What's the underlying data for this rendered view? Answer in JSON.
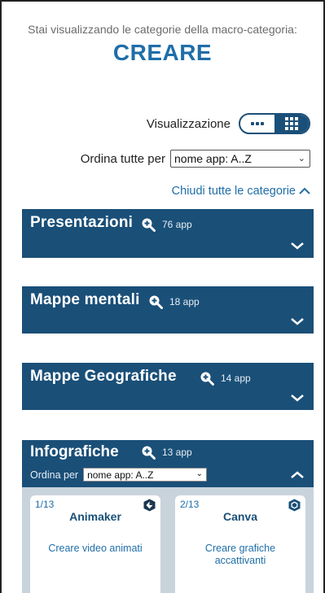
{
  "header": {
    "intro": "Stai visualizzando le categorie della macro-categoria:",
    "macro_category": "CREARE"
  },
  "view": {
    "label": "Visualizzazione",
    "modes": [
      "list",
      "grid"
    ],
    "active_mode": "grid"
  },
  "sort_all": {
    "label": "Ordina tutte per",
    "selected": "nome app: A..Z"
  },
  "close_all": {
    "label": "Chiudi tutte le categorie"
  },
  "categories": [
    {
      "title": "Presentazioni",
      "count": "76 app",
      "expanded": false
    },
    {
      "title": "Mappe mentali",
      "count": "18 app",
      "expanded": false
    },
    {
      "title": "Mappe Geografiche",
      "count": "14 app",
      "expanded": false
    },
    {
      "title": "Infografiche",
      "count": "13 app",
      "expanded": true
    }
  ],
  "infografiche": {
    "sort_label": "Ordina per",
    "sort_selected": "nome app: A..Z",
    "cards": [
      {
        "index": "1/13",
        "name": "Animaker",
        "description": "Creare video animati",
        "icon": "hexagon-icon"
      },
      {
        "index": "2/13",
        "name": "Canva",
        "description": "Creare grafiche accattivanti",
        "icon": "hexagon-icon"
      }
    ]
  },
  "colors": {
    "primary": "#1a4f78",
    "accent": "#1f6ea8",
    "panel_bg": "#c9d3dc"
  }
}
